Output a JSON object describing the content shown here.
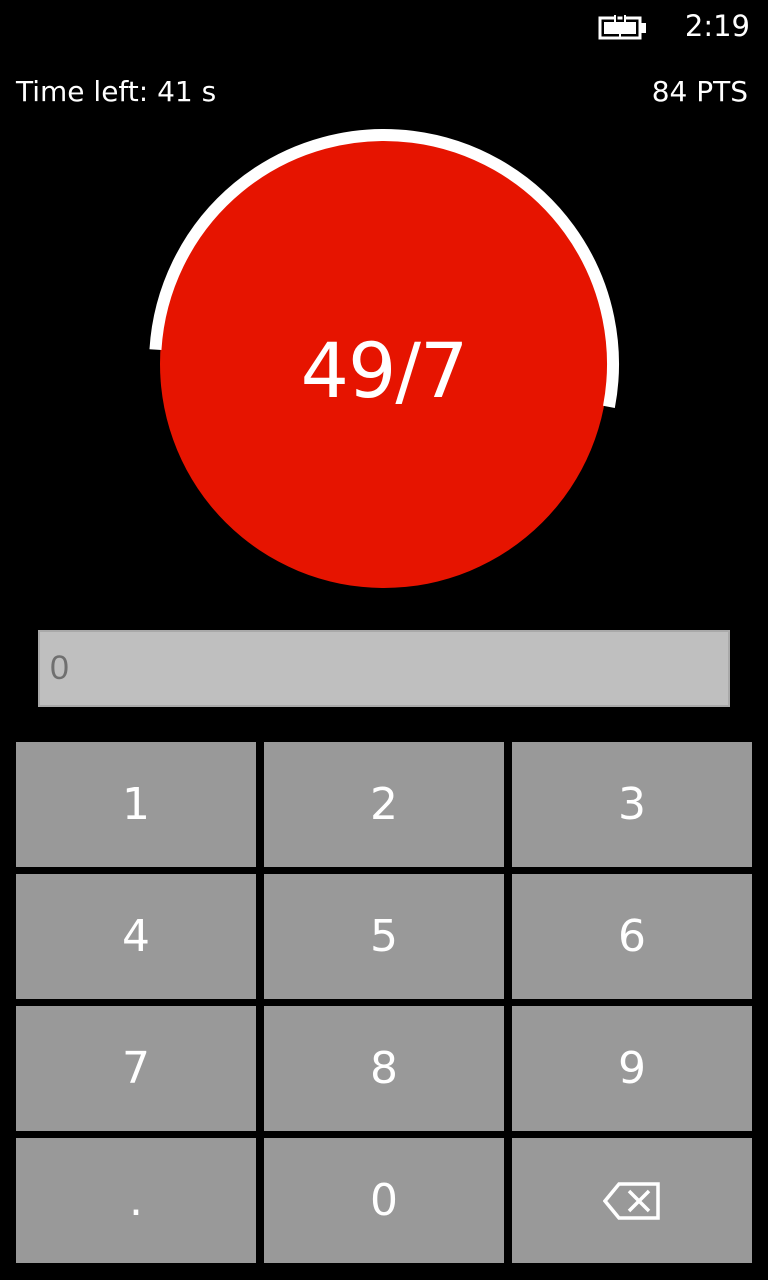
{
  "status_bar": {
    "time": "2:19",
    "battery_icon": "battery-charging-icon"
  },
  "header": {
    "time_left": "Time left: 41 s",
    "points": "84 PTS"
  },
  "timer": {
    "problem": "49/7",
    "circle_color": "#e61400",
    "remaining_fraction": 0.52
  },
  "answer_field": {
    "value": "0"
  },
  "keypad": {
    "keys": [
      "1",
      "2",
      "3",
      "4",
      "5",
      "6",
      "7",
      "8",
      "9",
      ".",
      "0"
    ],
    "backspace_icon": "backspace-icon"
  },
  "colors": {
    "background": "#000000",
    "key": "#999999",
    "answer_field": "#bfbfbf"
  }
}
